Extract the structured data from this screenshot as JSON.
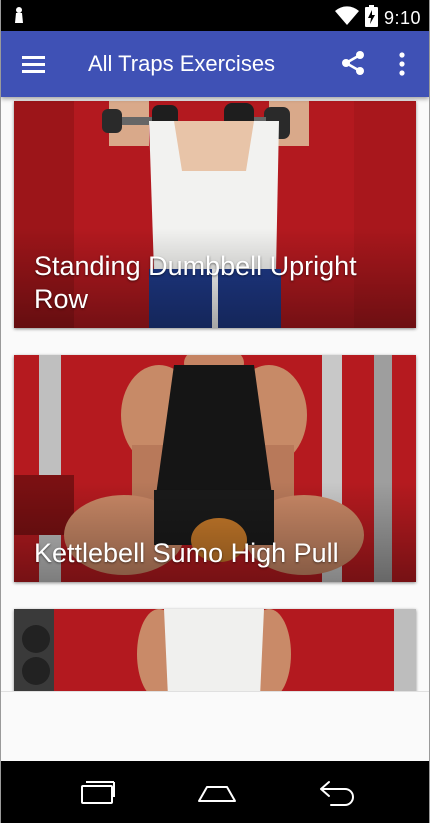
{
  "status_bar": {
    "time": "9:10",
    "icons": [
      "android-notification-icon",
      "wifi-icon",
      "battery-charging-icon"
    ]
  },
  "app_bar": {
    "title": "All Traps Exercises",
    "color": "#3f51b5",
    "left_icon": "hamburger-menu-icon",
    "right_icons": [
      "share-icon",
      "more-vert-icon"
    ]
  },
  "exercises": [
    {
      "title": "Standing Dumbbell Upright Row"
    },
    {
      "title": "Kettlebell Sumo High Pull"
    },
    {
      "title": ""
    }
  ],
  "nav_bar": {
    "buttons": [
      "recent-apps-icon",
      "home-icon",
      "back-icon"
    ]
  }
}
